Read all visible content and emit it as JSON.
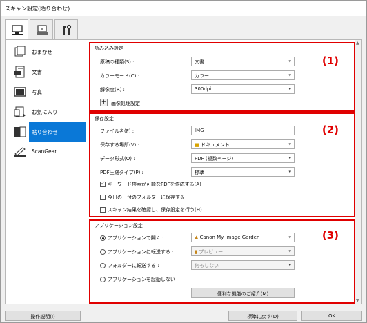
{
  "window": {
    "title": "スキャン設定(貼り合わせ)"
  },
  "tabs": [
    {
      "name": "scan-from-computer",
      "icon": "computer-scan-icon"
    },
    {
      "name": "scan-from-panel",
      "icon": "panel-scan-icon"
    },
    {
      "name": "general-settings",
      "icon": "tools-icon"
    }
  ],
  "sidebar": {
    "items": [
      {
        "label": "おまかせ",
        "icon": "auto-scan-icon"
      },
      {
        "label": "文書",
        "icon": "document-icon"
      },
      {
        "label": "写真",
        "icon": "photo-icon"
      },
      {
        "label": "お気に入り",
        "icon": "favorites-icon"
      },
      {
        "label": "貼り合わせ",
        "icon": "stitch-icon",
        "selected": true
      },
      {
        "label": "ScanGear",
        "icon": "scangear-icon"
      }
    ]
  },
  "scan_options": {
    "title": "読み込み設定",
    "number": "(1)",
    "paper_type_label": "原稿の種類(S) :",
    "paper_type_value": "文書",
    "color_mode_label": "カラーモード(C) :",
    "color_mode_value": "カラー",
    "resolution_label": "解像度(R) :",
    "resolution_value": "300dpi",
    "plus": "+",
    "image_processing_label": "画像処理設定"
  },
  "save_settings": {
    "title": "保存設定",
    "number": "(2)",
    "file_name_label": "ファイル名(F) :",
    "file_name_value": "IMG",
    "save_in_label": "保存する場所(V) :",
    "save_in_value": "ドキュメント",
    "data_format_label": "データ形式(O) :",
    "data_format_value": "PDF (複数ページ)",
    "pdf_compression_label": "PDF圧縮タイプ(P) :",
    "pdf_compression_value": "標準",
    "check_keyword_label": "キーワード検索が可能なPDFを作成する(A)",
    "check_keyword_checked": true,
    "check_date_folder_label": "今日の日付のフォルダーに保存する",
    "check_date_folder_checked": false,
    "check_confirm_label": "スキャン結果を確認し、保存設定を行う(H)",
    "check_confirm_checked": false
  },
  "app_settings": {
    "title": "アプリケーション設定",
    "number": "(3)",
    "open_app_label": "アプリケーションで開く :",
    "open_app_value": "Canon My Image Garden",
    "send_app_label": "アプリケーションに転送する :",
    "send_app_value": "プレビュー",
    "send_folder_label": "フォルダーに転送する :",
    "send_folder_value": "何もしない",
    "no_app_label": "アプリケーションを起動しない",
    "more_functions_label": "便利な機能のご紹介(M)",
    "selected": "open_app"
  },
  "footer": {
    "instructions_label": "操作説明(I)",
    "defaults_label": "標準に戻す(D)",
    "ok_label": "OK"
  },
  "colors": {
    "highlight": "#e00000",
    "selection": "#0a78d7"
  }
}
